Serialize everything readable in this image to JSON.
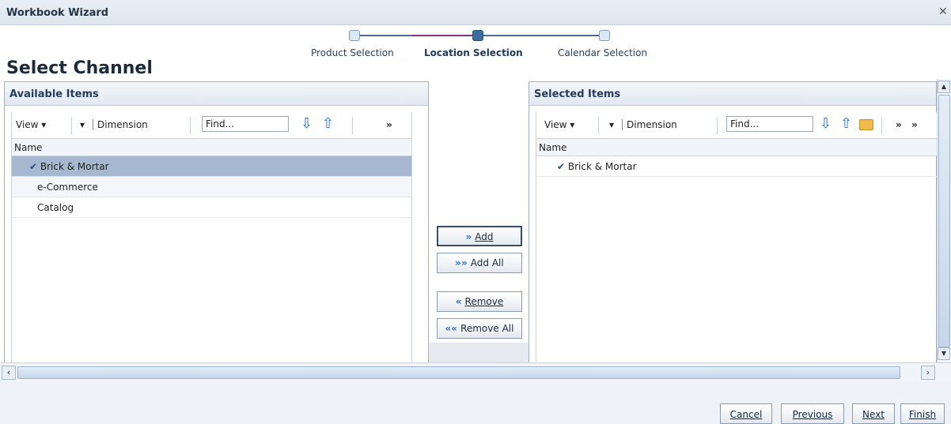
{
  "window": {
    "title": "Workbook Wizard",
    "close_glyph": "✕"
  },
  "train": {
    "steps": [
      {
        "label": "Product Selection",
        "current": false
      },
      {
        "label": "Location Selection",
        "current": true
      },
      {
        "label": "Calendar Selection",
        "current": false
      }
    ]
  },
  "page_title": "Select Channel",
  "available": {
    "header": "Available Items",
    "toolbar": {
      "view_label": "View ▾",
      "dimension_label": "Dimension",
      "find_placeholder": "Find...",
      "overflow_glyph": "»"
    },
    "column_header": "Name",
    "items": [
      {
        "label": "Brick & Mortar",
        "checked": true,
        "selected": true
      },
      {
        "label": "e-Commerce",
        "checked": false,
        "selected": false
      },
      {
        "label": "Catalog",
        "checked": false,
        "selected": false
      }
    ]
  },
  "selected": {
    "header": "Selected Items",
    "toolbar": {
      "view_label": "View ▾",
      "dimension_label": "Dimension",
      "find_placeholder": "Find...",
      "overflow_glyph": "»",
      "overflow_glyph_2": "»"
    },
    "column_header": "Name",
    "items": [
      {
        "label": "Brick & Mortar",
        "checked": true
      }
    ]
  },
  "shuttle": {
    "add": "Add",
    "add_all": "Add All",
    "remove": "Remove",
    "remove_all": "Remove All"
  },
  "footer": {
    "cancel": "Cancel",
    "previous": "Previous",
    "next": "Next",
    "finish": "Finish"
  },
  "scroll": {
    "left_glyph": "‹",
    "right_glyph": "›",
    "up_glyph": "▲",
    "down_glyph": "▼"
  },
  "icons": {
    "check": "✔",
    "arrow_down": "⇩",
    "arrow_up": "⇧",
    "add": "»",
    "add_all": "»»",
    "remove": "«",
    "remove_all": "««",
    "dropdown": "▾"
  },
  "colors": {
    "accent": "#3b6e9c",
    "selected_row": "#a6b8cf",
    "train_active": "#7a3a78"
  }
}
